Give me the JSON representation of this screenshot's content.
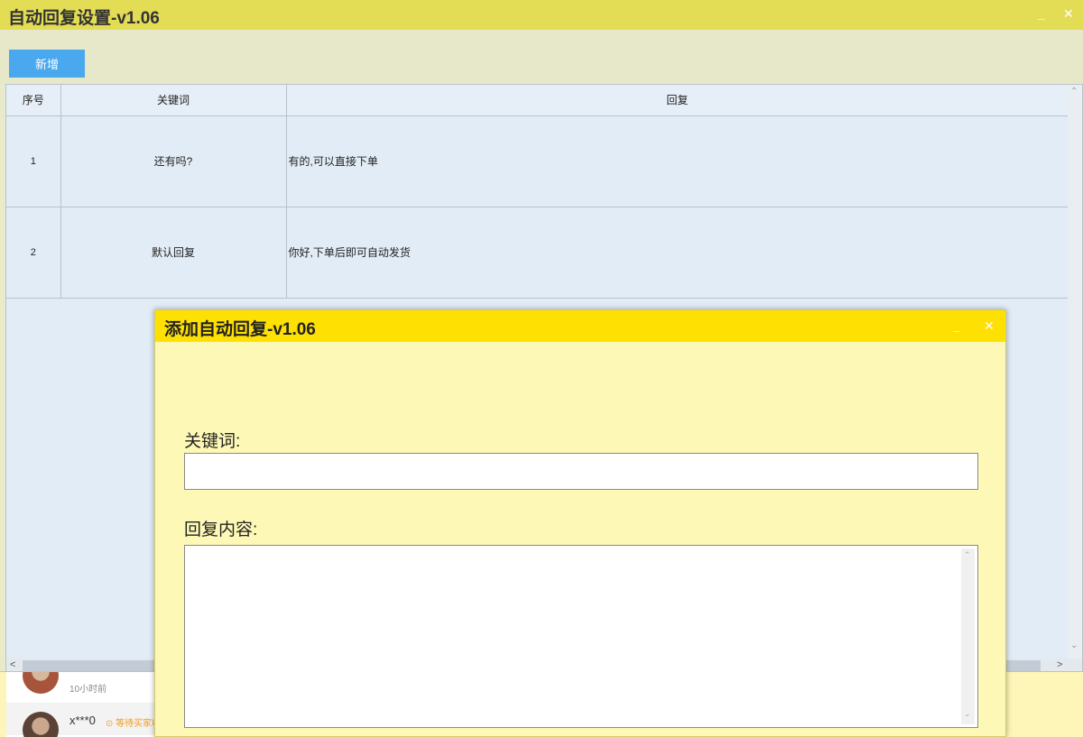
{
  "window": {
    "title": "自动回复设置-v1.06",
    "minimize_glyph": "_",
    "close_glyph": "✕"
  },
  "toolbar": {
    "add_label": "新增"
  },
  "table": {
    "headers": [
      "序号",
      "关键词",
      "回复"
    ],
    "rows": [
      {
        "index": "1",
        "keyword": "还有吗?",
        "reply": "有的,可以直接下单"
      },
      {
        "index": "2",
        "keyword": "默认回复",
        "reply": "你好,下单后即可自动发货"
      }
    ]
  },
  "scroll": {
    "up": "⌃",
    "down": "⌄",
    "left": "<",
    "right": ">"
  },
  "background_list": {
    "item1_time": "10小时前",
    "item2_user": "x***0",
    "item2_status": "⊙ 等待买家收"
  },
  "dialog": {
    "title": "添加自动回复-v1.06",
    "minimize_glyph": "_",
    "close_glyph": "✕",
    "keyword_label": "关键词:",
    "keyword_value": "",
    "reply_label": "回复内容:",
    "reply_value": ""
  },
  "colors": {
    "main_titlebar": "#e3dc55",
    "dialog_titlebar": "#ffe003",
    "dialog_body": "#fef8b6",
    "add_button": "#4aa8ee",
    "table_bg": "#e2ecf6"
  }
}
